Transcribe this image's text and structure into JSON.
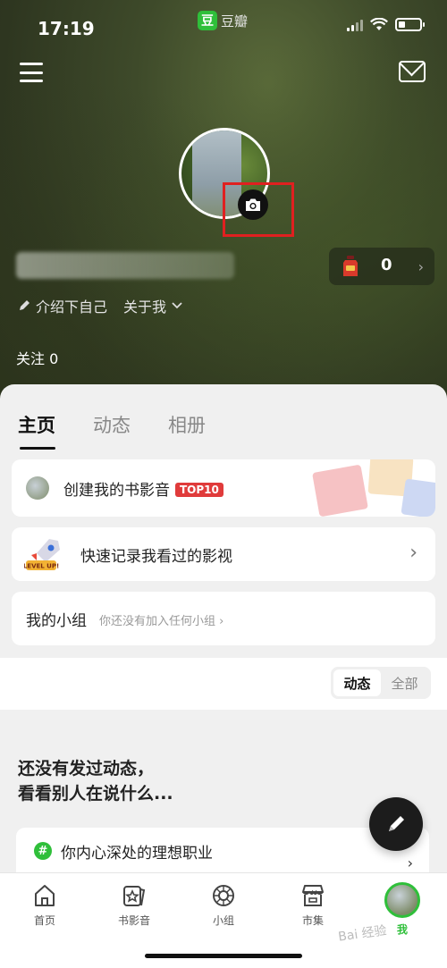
{
  "status_bar": {
    "time": "17:19",
    "app_name": "豆瓣",
    "app_logo_char": "豆"
  },
  "profile": {
    "intro_label": "介绍下自己",
    "about_label": "关于我",
    "follow_label": "关注 0",
    "flask_count": "0"
  },
  "tabs": [
    {
      "label": "主页",
      "active": true
    },
    {
      "label": "动态",
      "active": false
    },
    {
      "label": "相册",
      "active": false
    }
  ],
  "cards": {
    "create_list": {
      "label": "创建我的书影音",
      "badge": "TOP10"
    },
    "quick_record": {
      "label": "快速记录我看过的影视",
      "icon_text": "LEVEL UP!"
    },
    "my_groups": {
      "title": "我的小组",
      "subtitle": "你还没有加入任何小组 ›"
    }
  },
  "filter": {
    "options": [
      "动态",
      "全部"
    ],
    "selected": "动态"
  },
  "empty_state": {
    "line1": "还没有发过动态，",
    "line2": "看看别人在说什么..."
  },
  "topic": {
    "hash": "#",
    "label": "你内心深处的理想职业",
    "chevron": "›"
  },
  "bottom_nav": [
    {
      "label": "首页",
      "icon": "home-icon"
    },
    {
      "label": "书影音",
      "icon": "star-card-icon"
    },
    {
      "label": "小组",
      "icon": "group-icon"
    },
    {
      "label": "市集",
      "icon": "shop-icon"
    },
    {
      "label": "我",
      "icon": "avatar"
    }
  ],
  "watermark": "Bai 经验",
  "colors": {
    "brand_green": "#2fbf3a",
    "highlight_red": "#e02020",
    "badge_red": "#e03b3b"
  }
}
